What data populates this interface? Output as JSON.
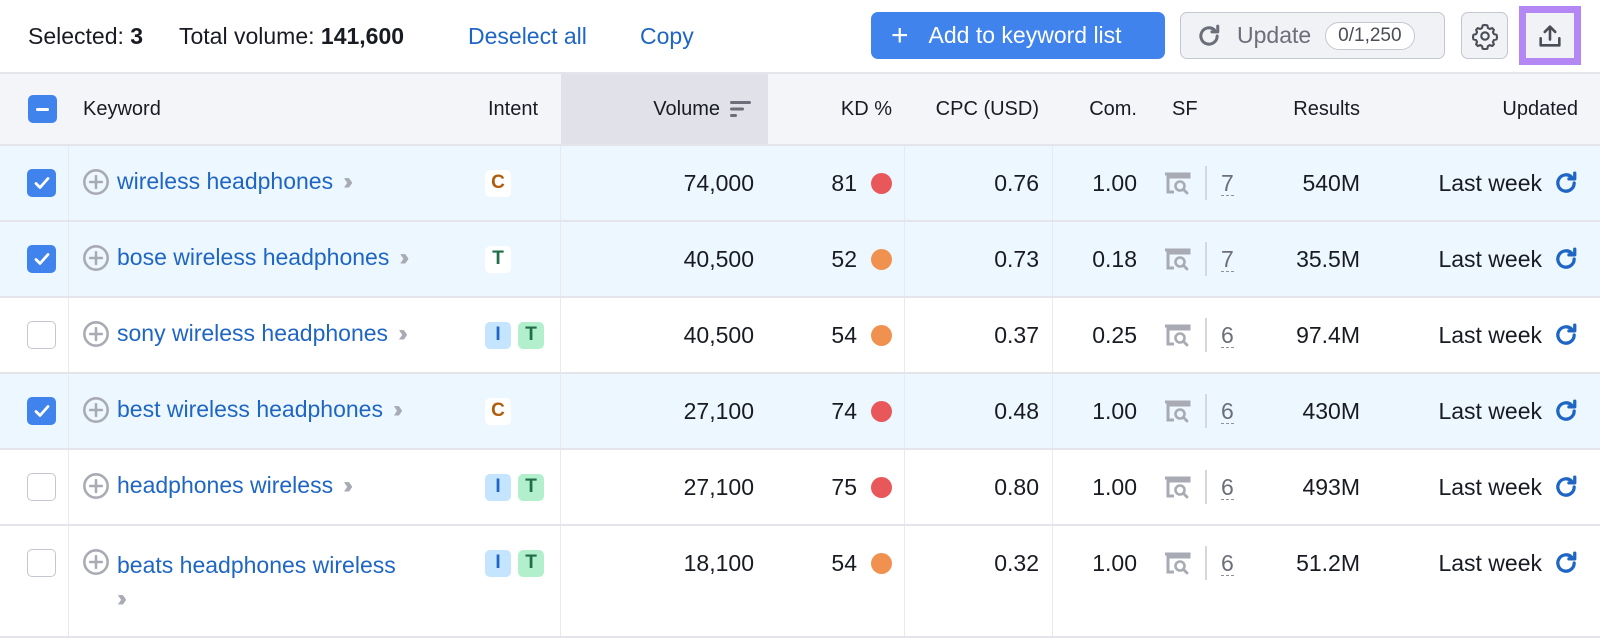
{
  "toolbar": {
    "selected_label": "Selected:",
    "selected_count": "3",
    "total_volume_label": "Total volume:",
    "total_volume": "141,600",
    "deselect_all": "Deselect all",
    "copy": "Copy",
    "add_to_list": "Add to keyword list",
    "update": "Update",
    "update_quota": "0/1,250"
  },
  "colors": {
    "accent": "#4083ec",
    "link": "#1f66c4",
    "export_highlight": "#b388f5",
    "kd_red": "#e8575a",
    "kd_orange": "#f0914f",
    "row_selected": "#edf7ff"
  },
  "columns": {
    "keyword": "Keyword",
    "intent": "Intent",
    "volume": "Volume",
    "kd": "KD %",
    "cpc": "CPC (USD)",
    "com": "Com.",
    "sf": "SF",
    "results": "Results",
    "updated": "Updated"
  },
  "rows": [
    {
      "selected": true,
      "keyword": "wireless headphones",
      "intent": [
        "C"
      ],
      "volume": "74,000",
      "kd": "81",
      "kd_level": "red",
      "cpc": "0.76",
      "com": "1.00",
      "sf": "7",
      "results": "540M",
      "updated": "Last week"
    },
    {
      "selected": true,
      "keyword": "bose wireless headphones",
      "intent": [
        "T"
      ],
      "volume": "40,500",
      "kd": "52",
      "kd_level": "orange",
      "cpc": "0.73",
      "com": "0.18",
      "sf": "7",
      "results": "35.5M",
      "updated": "Last week"
    },
    {
      "selected": false,
      "keyword": "sony wireless headphones",
      "intent": [
        "I",
        "T"
      ],
      "volume": "40,500",
      "kd": "54",
      "kd_level": "orange",
      "cpc": "0.37",
      "com": "0.25",
      "sf": "6",
      "results": "97.4M",
      "updated": "Last week"
    },
    {
      "selected": true,
      "keyword": "best wireless headphones",
      "intent": [
        "C"
      ],
      "volume": "27,100",
      "kd": "74",
      "kd_level": "red",
      "cpc": "0.48",
      "com": "1.00",
      "sf": "6",
      "results": "430M",
      "updated": "Last week"
    },
    {
      "selected": false,
      "keyword": "headphones wireless",
      "intent": [
        "I",
        "T"
      ],
      "volume": "27,100",
      "kd": "75",
      "kd_level": "red",
      "cpc": "0.80",
      "com": "1.00",
      "sf": "6",
      "results": "493M",
      "updated": "Last week"
    },
    {
      "selected": false,
      "keyword": "beats headphones wireless",
      "intent": [
        "I",
        "T"
      ],
      "volume": "18,100",
      "kd": "54",
      "kd_level": "orange",
      "cpc": "0.32",
      "com": "1.00",
      "sf": "6",
      "results": "51.2M",
      "updated": "Last week"
    }
  ]
}
